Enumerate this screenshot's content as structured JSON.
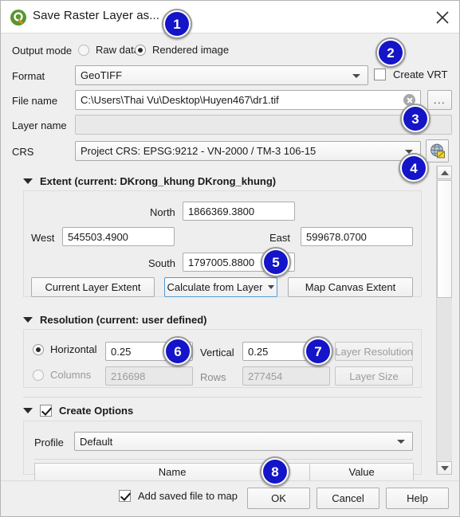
{
  "window": {
    "title": "Save Raster Layer as...",
    "logo_icon": "qgis-logo-icon",
    "close_icon": "close-icon"
  },
  "output_mode": {
    "label": "Output mode",
    "options": [
      {
        "label": "Raw data",
        "selected": false
      },
      {
        "label": "Rendered image",
        "selected": true
      }
    ]
  },
  "format": {
    "label": "Format",
    "value": "GeoTIFF",
    "create_vrt": {
      "label": "Create VRT",
      "checked": false
    }
  },
  "file_name": {
    "label": "File name",
    "value": "C:\\Users\\Thai Vu\\Desktop\\Huyen467\\dr1.tif",
    "clear_icon": "clear-icon",
    "browse_label": "..."
  },
  "layer_name": {
    "label": "Layer name",
    "value": "",
    "placeholder": ""
  },
  "crs": {
    "label": "CRS",
    "value": "Project CRS: EPSG:9212 - VN-2000 / TM-3 106-15",
    "select_icon": "globe-edit-icon"
  },
  "extent": {
    "header": "Extent (current: DKrong_khung DKrong_khung)",
    "north": {
      "label": "North",
      "value": "1866369.3800"
    },
    "west": {
      "label": "West",
      "value": "545503.4900"
    },
    "east": {
      "label": "East",
      "value": "599678.0700"
    },
    "south": {
      "label": "South",
      "value": "1797005.8800"
    },
    "buttons": {
      "current_layer_extent": "Current Layer Extent",
      "calculate_from_layer": "Calculate from Layer",
      "map_canvas_extent": "Map Canvas Extent"
    }
  },
  "resolution": {
    "header": "Resolution (current: user defined)",
    "horizontal": {
      "label": "Horizontal",
      "value": "0.25",
      "selected": true
    },
    "vertical": {
      "label": "Vertical",
      "value": "0.25"
    },
    "columns": {
      "label": "Columns",
      "value": "216698",
      "selected": false
    },
    "rows": {
      "label": "Rows",
      "value": "277454"
    },
    "layer_resolution_label": "Layer Resolution",
    "layer_size_label": "Layer Size"
  },
  "create_options": {
    "header": "Create Options",
    "checked": true,
    "profile": {
      "label": "Profile",
      "value": "Default"
    },
    "table": {
      "columns": [
        "Name",
        "Value"
      ]
    }
  },
  "footer": {
    "add_saved_file": {
      "label": "Add saved file to map",
      "checked": true
    },
    "ok": "OK",
    "cancel": "Cancel",
    "help": "Help"
  },
  "annotations": [
    {
      "number": "1"
    },
    {
      "number": "2"
    },
    {
      "number": "3"
    },
    {
      "number": "4"
    },
    {
      "number": "5"
    },
    {
      "number": "6"
    },
    {
      "number": "7"
    },
    {
      "number": "8"
    }
  ],
  "colors": {
    "badge_blue": "#1414c8",
    "dialog_bg": "#efefef",
    "titlebar_bg": "#ffffff",
    "focus_blue": "#4f9ad6",
    "qgis_green": "#589632"
  }
}
